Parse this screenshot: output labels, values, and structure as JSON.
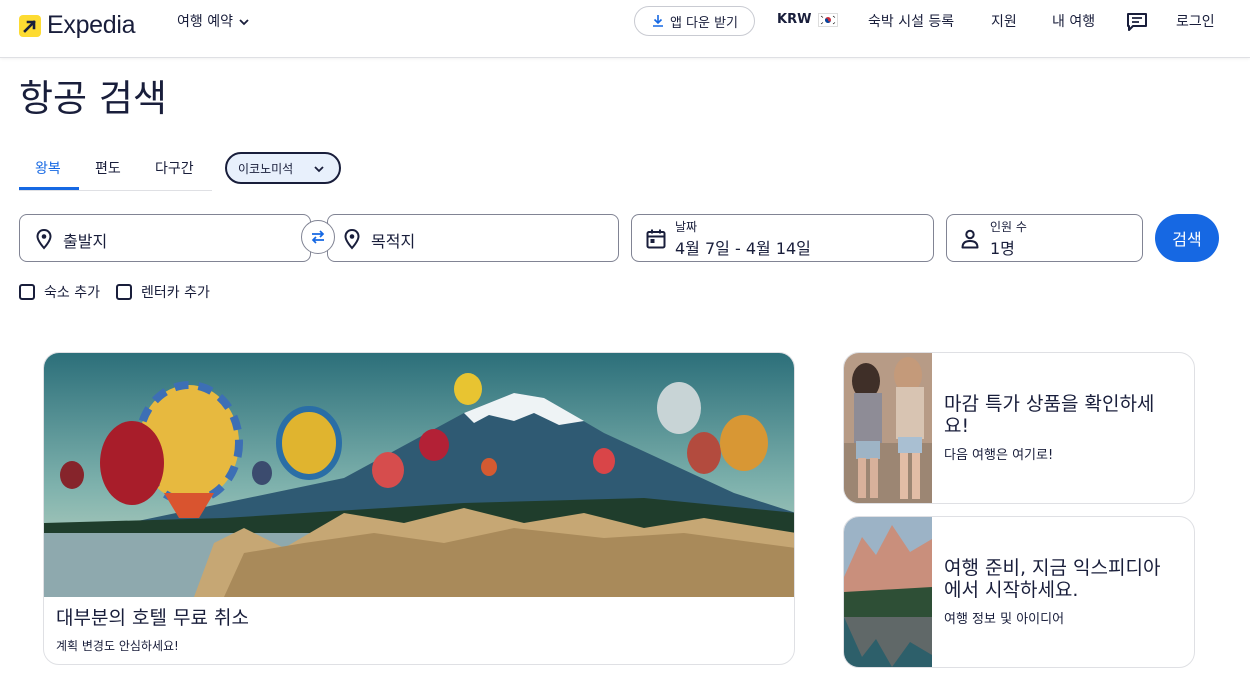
{
  "header": {
    "brand": "Expedia",
    "booking_menu": "여행 예약",
    "app_download": "앱 다운 받기",
    "currency": "KRW",
    "list_property": "숙박 시설 등록",
    "support": "지원",
    "my_trips": "내 여행",
    "login": "로그인"
  },
  "page": {
    "title": "항공 검색"
  },
  "tabs": {
    "items": [
      "왕복",
      "편도",
      "다구간"
    ],
    "active_index": 0
  },
  "cabin_class": {
    "selected": "이코노미석"
  },
  "search": {
    "origin_placeholder": "출발지",
    "destination_placeholder": "목적지",
    "date_label": "날짜",
    "date_value": "4월 7일 - 4월 14일",
    "travelers_label": "인원 수",
    "travelers_value": "1명",
    "search_button": "검색"
  },
  "options": {
    "add_stay": "숙소 추가",
    "add_car": "렌터카 추가"
  },
  "promos": {
    "main": {
      "title": "대부분의 호텔 무료 취소",
      "subtitle": "계획 변경도 안심하세요!"
    },
    "side1": {
      "title": "마감 특가 상품을 확인하세요!",
      "subtitle": "다음 여행은 여기로!"
    },
    "side2": {
      "title": "여행 준비, 지금 익스피디아에서 시작하세요.",
      "subtitle": "여행 정보 및 아이디어"
    }
  },
  "colors": {
    "brand_yellow": "#fddb32",
    "primary_blue": "#1668e3",
    "text_dark": "#191e3b"
  },
  "icons": [
    "download-icon",
    "chevron-down-icon",
    "chat-icon",
    "location-pin-icon",
    "swap-icon",
    "calendar-icon",
    "person-icon"
  ]
}
